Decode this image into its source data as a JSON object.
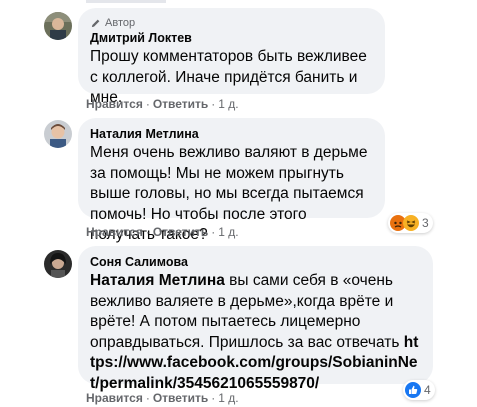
{
  "comments": [
    {
      "author_badge": "Автор",
      "name": "Дмитрий Локтев",
      "text": "Прошу комментаторов быть вежливее с коллегой. Иначе придётся банить и мне.",
      "actions": {
        "like": "Нравится",
        "reply": "Ответить",
        "time": "1 д."
      }
    },
    {
      "name": "Наталия Метлина",
      "text": "Меня очень вежливо валяют в дерьме за помощь! Мы не можем прыгнуть выше головы, но мы всегда пытаемся помочь! Но чтобы после этого получать такое?",
      "actions": {
        "like": "Нравится",
        "reply": "Ответить",
        "time": "1 д."
      },
      "reactions": {
        "icons": [
          "angry-icon",
          "laugh-icon"
        ],
        "count": "3"
      }
    },
    {
      "name": "Соня Салимова",
      "mention": "Наталия Метлина",
      "text": " вы сами себя в «очень вежливо валяете в дерьме»,когда врёте и врёте! А потом пытаетесь лицемерно оправдываться. Пришлось за вас отвечать ",
      "link": "https://www.facebook.com/groups/SobianinNet/permalink/3545621065559870/",
      "actions": {
        "like": "Нравится",
        "reply": "Ответить",
        "time": "1 д."
      },
      "reactions": {
        "icons": [
          "like-icon"
        ],
        "count": "4"
      }
    }
  ],
  "colors": {
    "bubble": "#f0f2f5",
    "meta": "#65676b",
    "like": "#1877f2",
    "angry": "#e9710f",
    "haha": "#f7b125"
  }
}
